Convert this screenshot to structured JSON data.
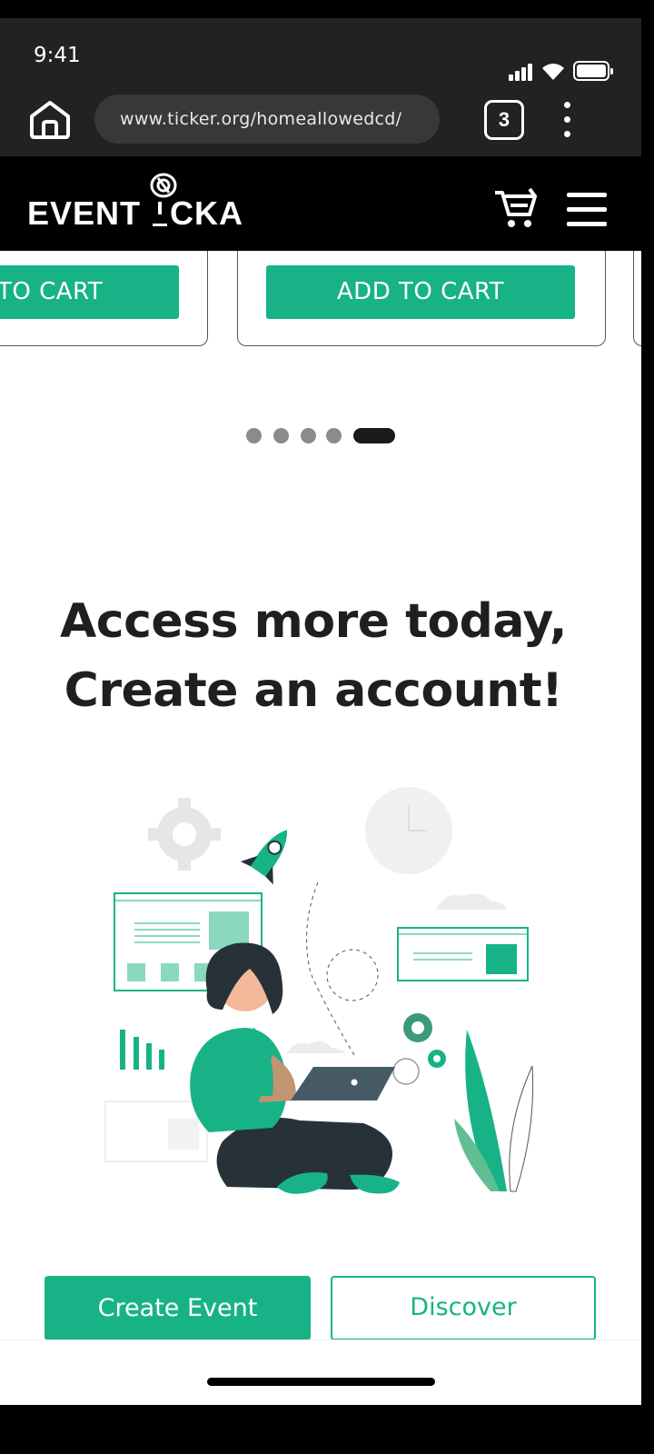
{
  "status_bar": {
    "time": "9:41"
  },
  "browser": {
    "url": "www.ticker.org/homeallowedcd/",
    "tab_count": "3"
  },
  "header": {
    "logo_left": "EVENT",
    "logo_right": "CKA"
  },
  "carousel": {
    "add_to_cart_label": "ADD TO CART",
    "partial_label": "TO CART",
    "slide_count": 5,
    "active_slide": 5
  },
  "main": {
    "headline_line1": "Access more today,",
    "headline_line2": "Create an account!"
  },
  "actions": {
    "create_event_label": "Create Event",
    "discover_label": "Discover"
  },
  "colors": {
    "accent": "#17b386",
    "header_bg": "#000000",
    "browser_bg": "#222222"
  }
}
